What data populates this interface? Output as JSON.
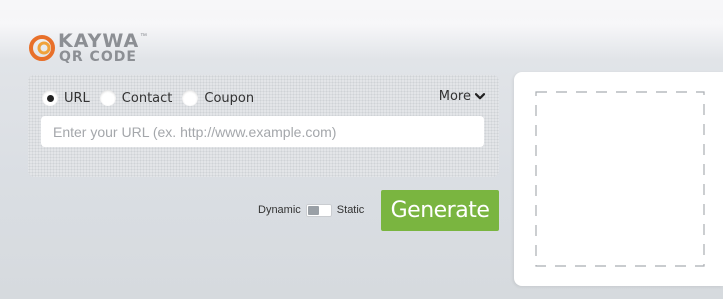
{
  "logo": {
    "line1": "KAYWA",
    "line2": "QR CODE",
    "tm": "™",
    "mark_colors": [
      "#e8702a",
      "#f0a23b"
    ]
  },
  "qr_type": {
    "options": [
      {
        "label": "URL",
        "selected": true
      },
      {
        "label": "Contact",
        "selected": false
      },
      {
        "label": "Coupon",
        "selected": false
      }
    ],
    "more_label": "More"
  },
  "url_field": {
    "value": "",
    "placeholder": "Enter your URL (ex. http://www.example.com)"
  },
  "mode": {
    "left_label": "Dynamic",
    "right_label": "Static",
    "selected": "Dynamic"
  },
  "generate_label": "Generate",
  "colors": {
    "accent_green": "#7ab540",
    "panel": "#e3e5e8",
    "placeholder_text": "#a4a7ab"
  }
}
